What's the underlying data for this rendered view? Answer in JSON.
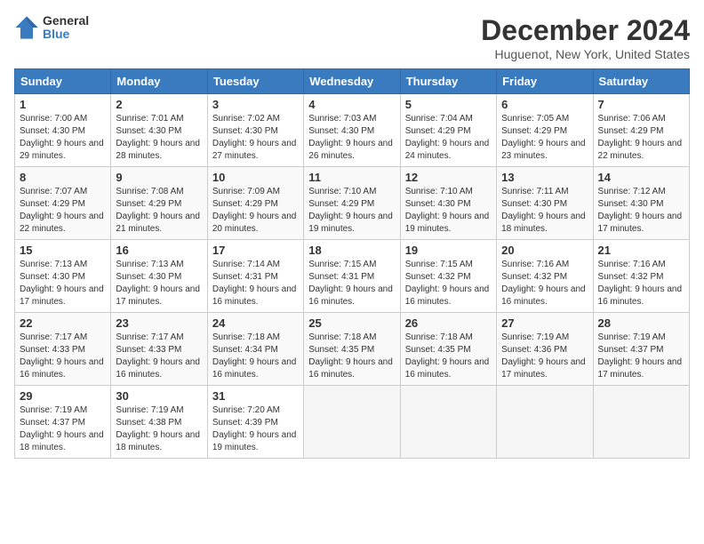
{
  "header": {
    "logo_line1": "General",
    "logo_line2": "Blue",
    "title": "December 2024",
    "subtitle": "Huguenot, New York, United States"
  },
  "calendar": {
    "headers": [
      "Sunday",
      "Monday",
      "Tuesday",
      "Wednesday",
      "Thursday",
      "Friday",
      "Saturday"
    ],
    "weeks": [
      [
        {
          "day": "1",
          "sunrise": "Sunrise: 7:00 AM",
          "sunset": "Sunset: 4:30 PM",
          "daylight": "Daylight: 9 hours and 29 minutes."
        },
        {
          "day": "2",
          "sunrise": "Sunrise: 7:01 AM",
          "sunset": "Sunset: 4:30 PM",
          "daylight": "Daylight: 9 hours and 28 minutes."
        },
        {
          "day": "3",
          "sunrise": "Sunrise: 7:02 AM",
          "sunset": "Sunset: 4:30 PM",
          "daylight": "Daylight: 9 hours and 27 minutes."
        },
        {
          "day": "4",
          "sunrise": "Sunrise: 7:03 AM",
          "sunset": "Sunset: 4:30 PM",
          "daylight": "Daylight: 9 hours and 26 minutes."
        },
        {
          "day": "5",
          "sunrise": "Sunrise: 7:04 AM",
          "sunset": "Sunset: 4:29 PM",
          "daylight": "Daylight: 9 hours and 24 minutes."
        },
        {
          "day": "6",
          "sunrise": "Sunrise: 7:05 AM",
          "sunset": "Sunset: 4:29 PM",
          "daylight": "Daylight: 9 hours and 23 minutes."
        },
        {
          "day": "7",
          "sunrise": "Sunrise: 7:06 AM",
          "sunset": "Sunset: 4:29 PM",
          "daylight": "Daylight: 9 hours and 22 minutes."
        }
      ],
      [
        {
          "day": "8",
          "sunrise": "Sunrise: 7:07 AM",
          "sunset": "Sunset: 4:29 PM",
          "daylight": "Daylight: 9 hours and 22 minutes."
        },
        {
          "day": "9",
          "sunrise": "Sunrise: 7:08 AM",
          "sunset": "Sunset: 4:29 PM",
          "daylight": "Daylight: 9 hours and 21 minutes."
        },
        {
          "day": "10",
          "sunrise": "Sunrise: 7:09 AM",
          "sunset": "Sunset: 4:29 PM",
          "daylight": "Daylight: 9 hours and 20 minutes."
        },
        {
          "day": "11",
          "sunrise": "Sunrise: 7:10 AM",
          "sunset": "Sunset: 4:29 PM",
          "daylight": "Daylight: 9 hours and 19 minutes."
        },
        {
          "day": "12",
          "sunrise": "Sunrise: 7:10 AM",
          "sunset": "Sunset: 4:30 PM",
          "daylight": "Daylight: 9 hours and 19 minutes."
        },
        {
          "day": "13",
          "sunrise": "Sunrise: 7:11 AM",
          "sunset": "Sunset: 4:30 PM",
          "daylight": "Daylight: 9 hours and 18 minutes."
        },
        {
          "day": "14",
          "sunrise": "Sunrise: 7:12 AM",
          "sunset": "Sunset: 4:30 PM",
          "daylight": "Daylight: 9 hours and 17 minutes."
        }
      ],
      [
        {
          "day": "15",
          "sunrise": "Sunrise: 7:13 AM",
          "sunset": "Sunset: 4:30 PM",
          "daylight": "Daylight: 9 hours and 17 minutes."
        },
        {
          "day": "16",
          "sunrise": "Sunrise: 7:13 AM",
          "sunset": "Sunset: 4:30 PM",
          "daylight": "Daylight: 9 hours and 17 minutes."
        },
        {
          "day": "17",
          "sunrise": "Sunrise: 7:14 AM",
          "sunset": "Sunset: 4:31 PM",
          "daylight": "Daylight: 9 hours and 16 minutes."
        },
        {
          "day": "18",
          "sunrise": "Sunrise: 7:15 AM",
          "sunset": "Sunset: 4:31 PM",
          "daylight": "Daylight: 9 hours and 16 minutes."
        },
        {
          "day": "19",
          "sunrise": "Sunrise: 7:15 AM",
          "sunset": "Sunset: 4:32 PM",
          "daylight": "Daylight: 9 hours and 16 minutes."
        },
        {
          "day": "20",
          "sunrise": "Sunrise: 7:16 AM",
          "sunset": "Sunset: 4:32 PM",
          "daylight": "Daylight: 9 hours and 16 minutes."
        },
        {
          "day": "21",
          "sunrise": "Sunrise: 7:16 AM",
          "sunset": "Sunset: 4:32 PM",
          "daylight": "Daylight: 9 hours and 16 minutes."
        }
      ],
      [
        {
          "day": "22",
          "sunrise": "Sunrise: 7:17 AM",
          "sunset": "Sunset: 4:33 PM",
          "daylight": "Daylight: 9 hours and 16 minutes."
        },
        {
          "day": "23",
          "sunrise": "Sunrise: 7:17 AM",
          "sunset": "Sunset: 4:33 PM",
          "daylight": "Daylight: 9 hours and 16 minutes."
        },
        {
          "day": "24",
          "sunrise": "Sunrise: 7:18 AM",
          "sunset": "Sunset: 4:34 PM",
          "daylight": "Daylight: 9 hours and 16 minutes."
        },
        {
          "day": "25",
          "sunrise": "Sunrise: 7:18 AM",
          "sunset": "Sunset: 4:35 PM",
          "daylight": "Daylight: 9 hours and 16 minutes."
        },
        {
          "day": "26",
          "sunrise": "Sunrise: 7:18 AM",
          "sunset": "Sunset: 4:35 PM",
          "daylight": "Daylight: 9 hours and 16 minutes."
        },
        {
          "day": "27",
          "sunrise": "Sunrise: 7:19 AM",
          "sunset": "Sunset: 4:36 PM",
          "daylight": "Daylight: 9 hours and 17 minutes."
        },
        {
          "day": "28",
          "sunrise": "Sunrise: 7:19 AM",
          "sunset": "Sunset: 4:37 PM",
          "daylight": "Daylight: 9 hours and 17 minutes."
        }
      ],
      [
        {
          "day": "29",
          "sunrise": "Sunrise: 7:19 AM",
          "sunset": "Sunset: 4:37 PM",
          "daylight": "Daylight: 9 hours and 18 minutes."
        },
        {
          "day": "30",
          "sunrise": "Sunrise: 7:19 AM",
          "sunset": "Sunset: 4:38 PM",
          "daylight": "Daylight: 9 hours and 18 minutes."
        },
        {
          "day": "31",
          "sunrise": "Sunrise: 7:20 AM",
          "sunset": "Sunset: 4:39 PM",
          "daylight": "Daylight: 9 hours and 19 minutes."
        },
        null,
        null,
        null,
        null
      ]
    ]
  }
}
